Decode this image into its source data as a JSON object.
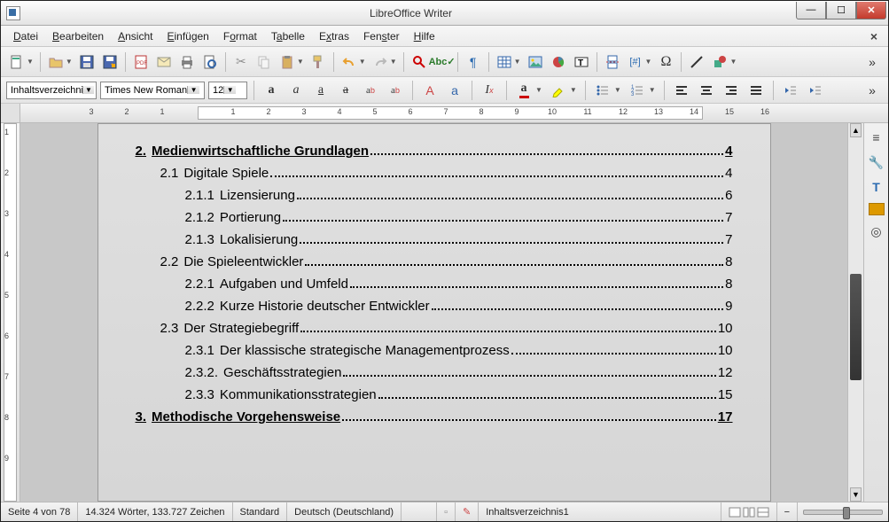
{
  "window": {
    "title": "LibreOffice Writer"
  },
  "menus": [
    "Datei",
    "Bearbeiten",
    "Ansicht",
    "Einfügen",
    "Format",
    "Tabelle",
    "Extras",
    "Fenster",
    "Hilfe"
  ],
  "format": {
    "style": "Inhaltsverzeichnis",
    "font": "Times New Roman",
    "size": "12"
  },
  "ruler": {
    "h_ticks": [
      -3,
      -2,
      -1,
      1,
      2,
      3,
      4,
      5,
      6,
      7,
      8,
      9,
      10,
      11,
      12,
      13,
      14,
      15,
      16
    ],
    "v_ticks": [
      1,
      2,
      3,
      4,
      5,
      6,
      7,
      8,
      9
    ]
  },
  "toc": [
    {
      "level": 0,
      "num": "2.",
      "text": "Medienwirtschaftliche Grundlagen",
      "page": "4"
    },
    {
      "level": 1,
      "num": "2.1",
      "text": "Digitale Spiele",
      "page": "4"
    },
    {
      "level": 2,
      "num": "2.1.1",
      "text": "Lizensierung",
      "page": "6"
    },
    {
      "level": 2,
      "num": "2.1.2",
      "text": "Portierung",
      "page": "7"
    },
    {
      "level": 2,
      "num": "2.1.3",
      "text": "Lokalisierung",
      "page": "7"
    },
    {
      "level": 1,
      "num": "2.2",
      "text": "Die Spieleentwickler",
      "page": "8"
    },
    {
      "level": 2,
      "num": "2.2.1",
      "text": "Aufgaben und Umfeld",
      "page": "8"
    },
    {
      "level": 2,
      "num": "2.2.2",
      "text": "Kurze Historie deutscher Entwickler",
      "page": "9"
    },
    {
      "level": 1,
      "num": "2.3",
      "text": "Der Strategiebegriff",
      "page": "10"
    },
    {
      "level": 2,
      "num": "2.3.1",
      "text": "Der klassische strategische Managementprozess",
      "page": "10"
    },
    {
      "level": 2,
      "num": "2.3.2.",
      "text": "Geschäftsstrategien",
      "page": "12"
    },
    {
      "level": 2,
      "num": "2.3.3",
      "text": "Kommunikationsstrategien",
      "page": "15"
    },
    {
      "level": 0,
      "num": "3.",
      "text": "Methodische Vorgehensweise",
      "page": "17"
    }
  ],
  "status": {
    "page": "Seite 4 von 78",
    "words": "14.324 Wörter, 133.727 Zeichen",
    "template": "Standard",
    "language": "Deutsch (Deutschland)",
    "style_name": "Inhaltsverzeichnis1",
    "zoom": "100"
  },
  "icons": {
    "new": "new",
    "open": "open",
    "save": "save",
    "saveas": "saveas",
    "pdf": "pdf",
    "mail": "mail",
    "print": "print",
    "preview": "preview",
    "cut": "cut",
    "copy": "copy",
    "paste": "paste",
    "clone": "clone",
    "brush": "brush",
    "undo": "undo",
    "redo": "redo",
    "find": "find",
    "spell": "spell",
    "pilcrow": "pilcrow",
    "table": "table",
    "image": "image",
    "chart": "chart",
    "textbox": "textbox",
    "pagebreak": "break",
    "field": "field",
    "special": "omega",
    "line": "line",
    "shapes": "shapes",
    "bold": "B",
    "italic": "I",
    "underline": "U",
    "strike": "S",
    "super": "x²",
    "sub": "x₂",
    "upper": "A",
    "lower": "a",
    "clearfmt": "Tx",
    "fontcolor": "A",
    "highlight": "mark",
    "bullets": "list",
    "numbering": "num",
    "indentdec": "←",
    "indentinc": "→",
    "alignl": "≡",
    "alignc": "≡",
    "alignr": "≡",
    "alignj": "≡"
  }
}
